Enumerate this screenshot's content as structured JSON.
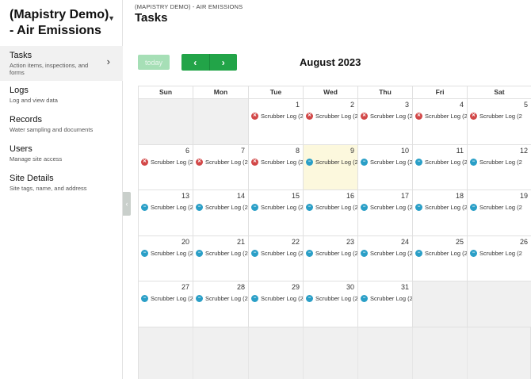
{
  "site": {
    "title": "(Mapistry Demo) - Air Emissions"
  },
  "sidebar": {
    "items": [
      {
        "label": "Tasks",
        "desc": "Action items, inspections, and forms",
        "active": true
      },
      {
        "label": "Logs",
        "desc": "Log and view data"
      },
      {
        "label": "Records",
        "desc": "Water sampling and documents"
      },
      {
        "label": "Users",
        "desc": "Manage site access"
      },
      {
        "label": "Site Details",
        "desc": "Site tags, name, and address"
      }
    ]
  },
  "header": {
    "breadcrumb": "(MAPISTRY DEMO) - AIR EMISSIONS",
    "title": "Tasks"
  },
  "toolbar": {
    "today_label": "today",
    "prev_icon": "‹",
    "next_icon": "›",
    "month": "August 2023"
  },
  "calendar": {
    "days": [
      "Sun",
      "Mon",
      "Tue",
      "Wed",
      "Thu",
      "Fri",
      "Sat"
    ],
    "weeks": [
      [
        {
          "day": "",
          "other": true
        },
        {
          "day": "",
          "other": true
        },
        {
          "day": "1",
          "event": "Scrubber Log (2",
          "status": "overdue"
        },
        {
          "day": "2",
          "event": "Scrubber Log (2",
          "status": "overdue"
        },
        {
          "day": "3",
          "event": "Scrubber Log (2",
          "status": "overdue"
        },
        {
          "day": "4",
          "event": "Scrubber Log (2",
          "status": "overdue"
        },
        {
          "day": "5",
          "event": "Scrubber Log (2",
          "status": "overdue"
        }
      ],
      [
        {
          "day": "6",
          "event": "Scrubber Log (2",
          "status": "overdue"
        },
        {
          "day": "7",
          "event": "Scrubber Log (2",
          "status": "overdue"
        },
        {
          "day": "8",
          "event": "Scrubber Log (2",
          "status": "overdue"
        },
        {
          "day": "9",
          "event": "Scrubber Log (2",
          "status": "upcoming",
          "today": true
        },
        {
          "day": "10",
          "event": "Scrubber Log (2",
          "status": "upcoming"
        },
        {
          "day": "11",
          "event": "Scrubber Log (2",
          "status": "upcoming"
        },
        {
          "day": "12",
          "event": "Scrubber Log (2",
          "status": "upcoming"
        }
      ],
      [
        {
          "day": "13",
          "event": "Scrubber Log (2",
          "status": "upcoming"
        },
        {
          "day": "14",
          "event": "Scrubber Log (2",
          "status": "upcoming"
        },
        {
          "day": "15",
          "event": "Scrubber Log (2",
          "status": "upcoming"
        },
        {
          "day": "16",
          "event": "Scrubber Log (2",
          "status": "upcoming"
        },
        {
          "day": "17",
          "event": "Scrubber Log (2",
          "status": "upcoming"
        },
        {
          "day": "18",
          "event": "Scrubber Log (2",
          "status": "upcoming"
        },
        {
          "day": "19",
          "event": "Scrubber Log (2",
          "status": "upcoming"
        }
      ],
      [
        {
          "day": "20",
          "event": "Scrubber Log (2",
          "status": "upcoming"
        },
        {
          "day": "21",
          "event": "Scrubber Log (2",
          "status": "upcoming"
        },
        {
          "day": "22",
          "event": "Scrubber Log (2",
          "status": "upcoming"
        },
        {
          "day": "23",
          "event": "Scrubber Log (2",
          "status": "upcoming"
        },
        {
          "day": "24",
          "event": "Scrubber Log (2",
          "status": "upcoming"
        },
        {
          "day": "25",
          "event": "Scrubber Log (2",
          "status": "upcoming"
        },
        {
          "day": "26",
          "event": "Scrubber Log (2",
          "status": "upcoming"
        }
      ],
      [
        {
          "day": "27",
          "event": "Scrubber Log (2",
          "status": "upcoming"
        },
        {
          "day": "28",
          "event": "Scrubber Log (2",
          "status": "upcoming"
        },
        {
          "day": "29",
          "event": "Scrubber Log (2",
          "status": "upcoming"
        },
        {
          "day": "30",
          "event": "Scrubber Log (2",
          "status": "upcoming"
        },
        {
          "day": "31",
          "event": "Scrubber Log (2",
          "status": "upcoming"
        },
        {
          "day": "",
          "other": true
        },
        {
          "day": "",
          "other": true
        }
      ]
    ]
  },
  "colors": {
    "accent": "#22a448",
    "overdue": "#d24848",
    "upcoming": "#2a9fc7",
    "today_bg": "#fcf8dd"
  },
  "icons": {
    "overdue": "x-circle-icon",
    "upcoming": "minus-circle-icon",
    "chevron": "chevron-right-icon",
    "caret": "caret-down-icon"
  }
}
